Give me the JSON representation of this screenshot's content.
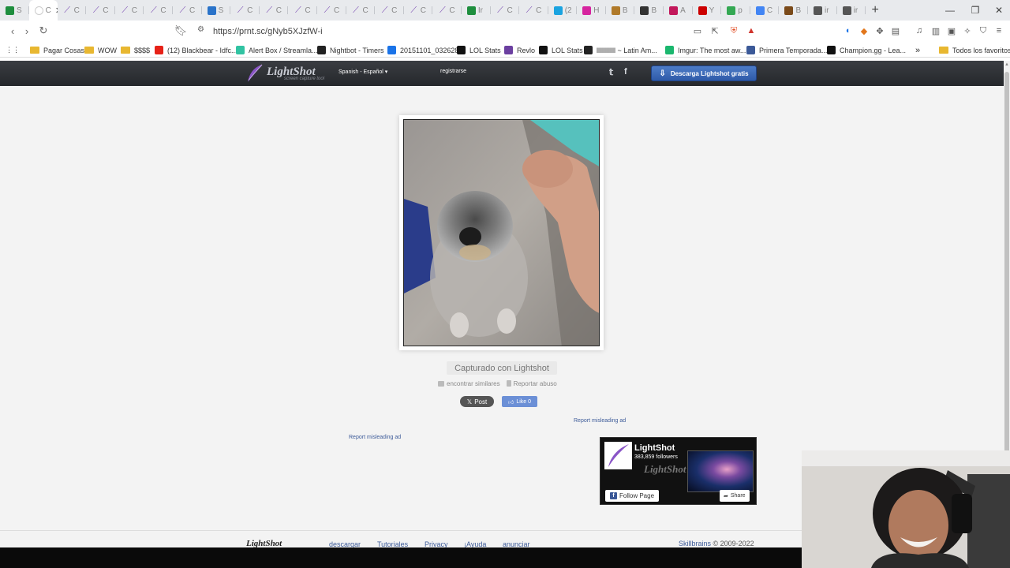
{
  "browser": {
    "tabs": [
      {
        "letter": "S",
        "color": "#1e8e3e"
      },
      {
        "letter": "C",
        "color": "#ffffff",
        "active": true
      },
      {
        "letter": "C",
        "color": "#7b4db3"
      },
      {
        "letter": "C",
        "color": "#7b4db3"
      },
      {
        "letter": "C",
        "color": "#7b4db3"
      },
      {
        "letter": "C",
        "color": "#7b4db3"
      },
      {
        "letter": "C",
        "color": "#7b4db3"
      },
      {
        "letter": "S",
        "color": "#2a73c9"
      },
      {
        "letter": "C",
        "color": "#7b4db3"
      },
      {
        "letter": "C",
        "color": "#7b4db3"
      },
      {
        "letter": "C",
        "color": "#7b4db3"
      },
      {
        "letter": "C",
        "color": "#7b4db3"
      },
      {
        "letter": "C",
        "color": "#7b4db3"
      },
      {
        "letter": "C",
        "color": "#7b4db3"
      },
      {
        "letter": "C",
        "color": "#7b4db3"
      },
      {
        "letter": "C",
        "color": "#7b4db3"
      },
      {
        "letter": "Ir",
        "color": "#1e8e3e"
      },
      {
        "letter": "C",
        "color": "#7b4db3"
      },
      {
        "letter": "C",
        "color": "#7b4db3"
      },
      {
        "letter": "(2",
        "color": "#1aa3e0"
      },
      {
        "letter": "H",
        "color": "#d6249f"
      },
      {
        "letter": "B",
        "color": "#b07a2a"
      },
      {
        "letter": "B",
        "color": "#333333"
      },
      {
        "letter": "A",
        "color": "#c2185b"
      },
      {
        "letter": "Y",
        "color": "#cc0000"
      },
      {
        "letter": "p",
        "color": "#34a853"
      },
      {
        "letter": "C",
        "color": "#4285f4"
      },
      {
        "letter": "B",
        "color": "#7a4a1a"
      },
      {
        "letter": "ir",
        "color": "#555555"
      },
      {
        "letter": "ir",
        "color": "#555555"
      }
    ],
    "active_tab_close": "✕",
    "new_tab": "+",
    "url": "https://prnt.sc/gNyb5XJzfW-i",
    "bookmarks": [
      {
        "label": "Pagar Cosas",
        "type": "folder"
      },
      {
        "label": "WOW",
        "type": "folder"
      },
      {
        "label": "$$$$",
        "type": "folder"
      },
      {
        "label": "(12) Blackbear - Idfc...",
        "type": "site",
        "color": "#e62117"
      },
      {
        "label": "Alert Box / Streamla...",
        "type": "site",
        "color": "#31c3a2"
      },
      {
        "label": "Nightbot - Timers",
        "type": "site",
        "color": "#222222"
      },
      {
        "label": "20151101_032628",
        "type": "site",
        "color": "#1a73e8"
      },
      {
        "label": "LOL Stats",
        "type": "site",
        "color": "#111111"
      },
      {
        "label": "Revlo",
        "type": "site",
        "color": "#6b3fa0"
      },
      {
        "label": "LOL Stats",
        "type": "site",
        "color": "#111111"
      },
      {
        "label": "llllllllllll ~ Latin Am...",
        "type": "site",
        "color": "#222222"
      },
      {
        "label": "Imgur: The most aw...",
        "type": "site",
        "color": "#1bb76e"
      },
      {
        "label": "Primera Temporada...",
        "type": "site",
        "color": "#3b5998"
      },
      {
        "label": "Champion.gg - Lea...",
        "type": "site",
        "color": "#111111"
      }
    ],
    "bookmarks_overflow": "»",
    "all_bookmarks": "Todos los favoritos"
  },
  "site": {
    "logo_text": "LightShot",
    "logo_sub": "screen capture tool",
    "language": "Spanish - Español",
    "register": "registrarse",
    "download_button": "Descarga Lightshot gratis",
    "caption": "Capturado con Lightshot",
    "find_similar": "encontrar similares",
    "report_abuse": "Reportar abuso",
    "post_button": "Post",
    "like_button": "Like 0",
    "report_ad_1": "Report misleading ad",
    "report_ad_2": "Report misleading ad",
    "fb_widget": {
      "name": "LightShot",
      "followers": "383,859 followers",
      "brand": "LightShot",
      "follow": "Follow Page",
      "share": "Share"
    },
    "footer": {
      "logo": "LightShot",
      "links": [
        "descargar",
        "Tutoriales",
        "Privacy",
        "¡Ayuda",
        "anunciar"
      ],
      "company": "Skillbrains",
      "copyright": " © 2009-2022"
    }
  },
  "colors": {
    "header_bg": "#2f3136",
    "download_btn": "#3a66b5",
    "page_bg": "#f3f3f3",
    "link": "#3d5b99"
  }
}
